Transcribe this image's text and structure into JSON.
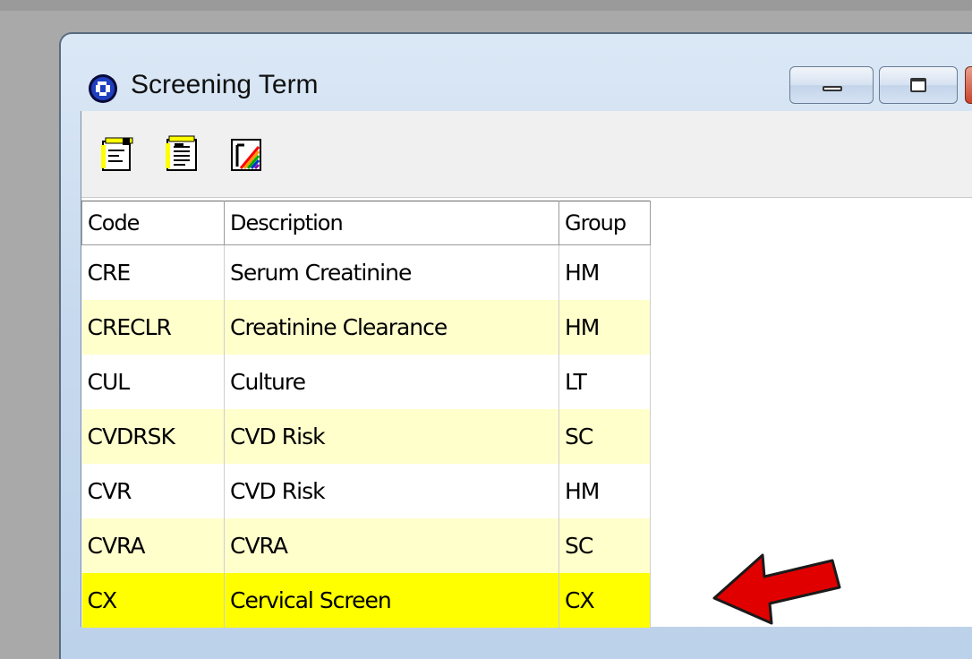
{
  "window": {
    "title": "Screening Term"
  },
  "toolbar": {
    "buttons": [
      {
        "icon": "new-record-icon"
      },
      {
        "icon": "edit-record-icon"
      },
      {
        "icon": "print-report-icon"
      }
    ]
  },
  "table": {
    "headers": {
      "code": "Code",
      "description": "Description",
      "group": "Group"
    },
    "rows": [
      {
        "code": "CRE",
        "description": "Serum Creatinine",
        "group": "HM"
      },
      {
        "code": "CRECLR",
        "description": "Creatinine Clearance",
        "group": "HM"
      },
      {
        "code": "CUL",
        "description": "Culture",
        "group": "LT"
      },
      {
        "code": "CVDRSK",
        "description": "CVD Risk",
        "group": "SC"
      },
      {
        "code": "CVR",
        "description": "CVD Risk",
        "group": "HM"
      },
      {
        "code": "CVRA",
        "description": "CVRA",
        "group": "SC"
      },
      {
        "code": "CX",
        "description": "Cervical Screen",
        "group": "CX"
      }
    ],
    "selected_row": 6
  },
  "colors": {
    "alt_row": "#ffffcc",
    "selected_row": "#ffff00",
    "annotation_arrow": "#e00000"
  }
}
